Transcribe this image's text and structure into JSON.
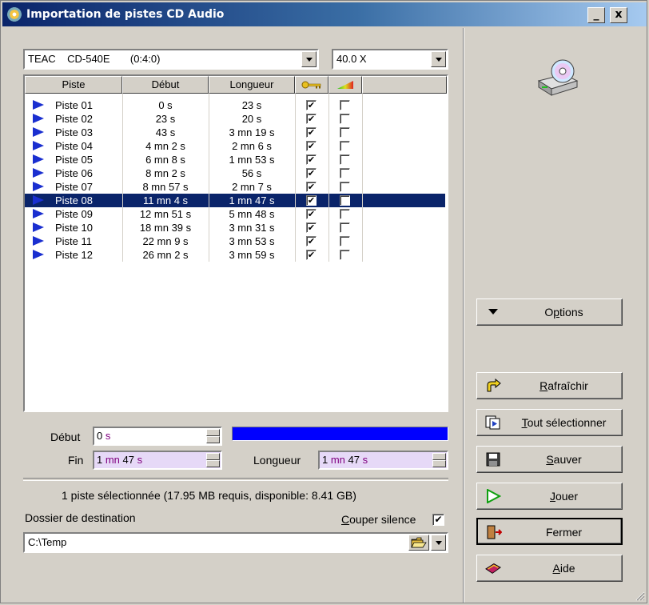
{
  "window": {
    "title": "Importation de pistes CD Audio",
    "minimize": "_",
    "close": "x"
  },
  "drive": {
    "selected": "TEAC    CD-540E       (0:4:0)"
  },
  "speed": {
    "selected": "40.0 X"
  },
  "list": {
    "headers": [
      "Piste",
      "Début",
      "Longueur"
    ],
    "key_icon": "key-icon",
    "level_icon": "volume-level-icon",
    "rows": [
      {
        "piste": "Piste 01",
        "debut": "0 s",
        "longueur": "23 s",
        "checked": true,
        "second": false
      },
      {
        "piste": "Piste 02",
        "debut": "23 s",
        "longueur": "20 s",
        "checked": true,
        "second": false
      },
      {
        "piste": "Piste 03",
        "debut": "43 s",
        "longueur": "3 mn 19 s",
        "checked": true,
        "second": false
      },
      {
        "piste": "Piste 04",
        "debut": "4 mn 2 s",
        "longueur": "2 mn 6 s",
        "checked": true,
        "second": false
      },
      {
        "piste": "Piste 05",
        "debut": "6 mn 8 s",
        "longueur": "1 mn 53 s",
        "checked": true,
        "second": false
      },
      {
        "piste": "Piste 06",
        "debut": "8 mn 2 s",
        "longueur": "56 s",
        "checked": true,
        "second": false
      },
      {
        "piste": "Piste 07",
        "debut": "8 mn 57 s",
        "longueur": "2 mn 7 s",
        "checked": true,
        "second": false
      },
      {
        "piste": "Piste 08",
        "debut": "11 mn 4 s",
        "longueur": "1 mn 47 s",
        "checked": true,
        "second": false,
        "selected": true
      },
      {
        "piste": "Piste 09",
        "debut": "12 mn 51 s",
        "longueur": "5 mn 48 s",
        "checked": true,
        "second": false
      },
      {
        "piste": "Piste 10",
        "debut": "18 mn 39 s",
        "longueur": "3 mn 31 s",
        "checked": true,
        "second": false
      },
      {
        "piste": "Piste 11",
        "debut": "22 mn 9 s",
        "longueur": "3 mn 53 s",
        "checked": true,
        "second": false
      },
      {
        "piste": "Piste 12",
        "debut": "26 mn 2 s",
        "longueur": "3 mn 59 s",
        "checked": true,
        "second": false
      }
    ]
  },
  "debut": {
    "label": "Début",
    "value": "0 s"
  },
  "fin": {
    "label": "Fin",
    "value": "1 mn 47 s"
  },
  "longueur": {
    "label": "Longueur",
    "value": "1 mn 47 s"
  },
  "progress": {
    "fraction": 1.0,
    "color": "#0000ff"
  },
  "status": "1 piste sélectionnée (17.95 MB requis, disponible: 8.41 GB)",
  "destination": {
    "label": "Dossier de destination",
    "value": "C:\\Temp"
  },
  "silence": {
    "label": "Couper silence",
    "checked": true
  },
  "buttons": {
    "options": "Options",
    "refresh": "Rafraîchir",
    "select_all": "Tout sélectionner",
    "save": "Sauver",
    "play": "Jouer",
    "close": "Fermer",
    "help": "Aide"
  },
  "colors": {
    "selection": "#0a246a",
    "track_icon": "#1a2fd0",
    "accent_text": "#800080"
  }
}
